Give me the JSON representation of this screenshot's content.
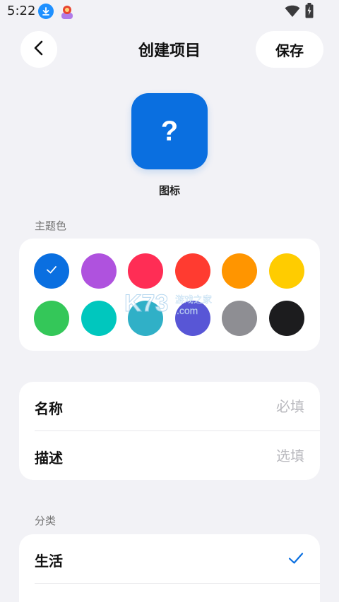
{
  "status_bar": {
    "time": "5:22",
    "icons": [
      "download-icon",
      "app-notification-icon",
      "wifi-icon",
      "battery-charging-icon"
    ]
  },
  "header": {
    "back_icon": "chevron-left-icon",
    "title": "创建项目",
    "save_label": "保存"
  },
  "project_icon": {
    "glyph": "?",
    "label": "图标",
    "color": "#0a6fe0"
  },
  "theme_color": {
    "section_label": "主题色",
    "selected_index": 0,
    "swatches": [
      {
        "color": "#0a6fe0",
        "selected": true
      },
      {
        "color": "#af52de",
        "selected": false
      },
      {
        "color": "#ff2d55",
        "selected": false
      },
      {
        "color": "#ff3b30",
        "selected": false
      },
      {
        "color": "#ff9500",
        "selected": false
      },
      {
        "color": "#ffcc00",
        "selected": false
      },
      {
        "color": "#34c759",
        "selected": false
      },
      {
        "color": "#00c7be",
        "selected": false
      },
      {
        "color": "#30b0c7",
        "selected": false
      },
      {
        "color": "#5856d6",
        "selected": false
      },
      {
        "color": "#8e8e93",
        "selected": false
      },
      {
        "color": "#1c1c1e",
        "selected": false
      }
    ]
  },
  "form": {
    "name_label": "名称",
    "name_value": "",
    "name_placeholder": "必填",
    "desc_label": "描述",
    "desc_value": "",
    "desc_placeholder": "选填"
  },
  "category": {
    "section_label": "分类",
    "items": [
      {
        "label": "生活",
        "selected": true
      }
    ]
  },
  "watermark": {
    "logo_text": "K73",
    "sub_text": "游戏之家",
    "domain_text": ".com"
  },
  "colors": {
    "background": "#f2f2f6",
    "card": "#ffffff",
    "accent": "#0a6fe0"
  }
}
